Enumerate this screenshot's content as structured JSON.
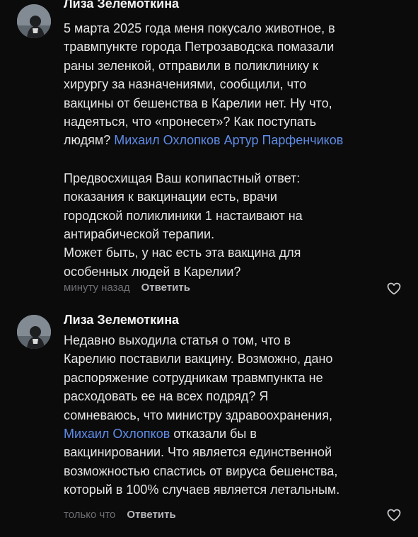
{
  "comments": [
    {
      "author": "Лиза Зелемоткина",
      "lines": [
        [
          "5 марта 2025 года меня покусало животное, в"
        ],
        [
          "травмпункте города Петрозаводска помазали"
        ],
        [
          "раны зеленкой, отправили в поликлинику к"
        ],
        [
          "хирургу за назначениями, сообщили, что"
        ],
        [
          "вакцины от бешенства в Карелии нет. Ну что,"
        ],
        [
          "надеяться, что «пронесет»? Как поступать"
        ],
        [
          "людям? ",
          "Михаил Охлопков",
          " ",
          "Артур Парфенчиков"
        ],
        [
          "Предвосхищая Ваш копипастный ответ:"
        ],
        [
          "показания к вакцинации есть, врачи"
        ],
        [
          "городской поликлиники 1 настаивают на"
        ],
        [
          "антирабической терапии."
        ],
        [
          "Может быть, у нас есть эта вакцина для"
        ],
        [
          "особенных людей в Карелии?"
        ]
      ],
      "mentions": [
        "Михаил Охлопков",
        "Артур Парфенчиков"
      ],
      "time": "минуту назад",
      "reply_label": "Ответить",
      "like_icon": "heart-outline-icon"
    },
    {
      "author": "Лиза Зелемоткина",
      "lines": [
        [
          "Недавно выходила статья о том, что в"
        ],
        [
          "Карелию поставили вакцину. Возможно, дано"
        ],
        [
          "распоряжение сотрудникам травмпункта не"
        ],
        [
          "расходовать ее на всех подряд? Я"
        ],
        [
          "сомневаюсь, что министру здравоохранения,"
        ],
        [
          "Михаил Охлопков",
          " отказали бы в"
        ],
        [
          "вакцинировании. Что является единственной"
        ],
        [
          "возможностью спастись от вируса бешенства,"
        ],
        [
          "который в 100% случаев является летальным."
        ]
      ],
      "mentions": [
        "Михаил Охлопков"
      ],
      "time": "только что",
      "reply_label": "Ответить",
      "like_icon": "heart-outline-icon"
    }
  ],
  "colors": {
    "background": "#0b0b0c",
    "text": "#e6e6e7",
    "mention": "#5f8ce6",
    "timestamp": "#6f6f73",
    "reply": "#b9b9bd"
  }
}
